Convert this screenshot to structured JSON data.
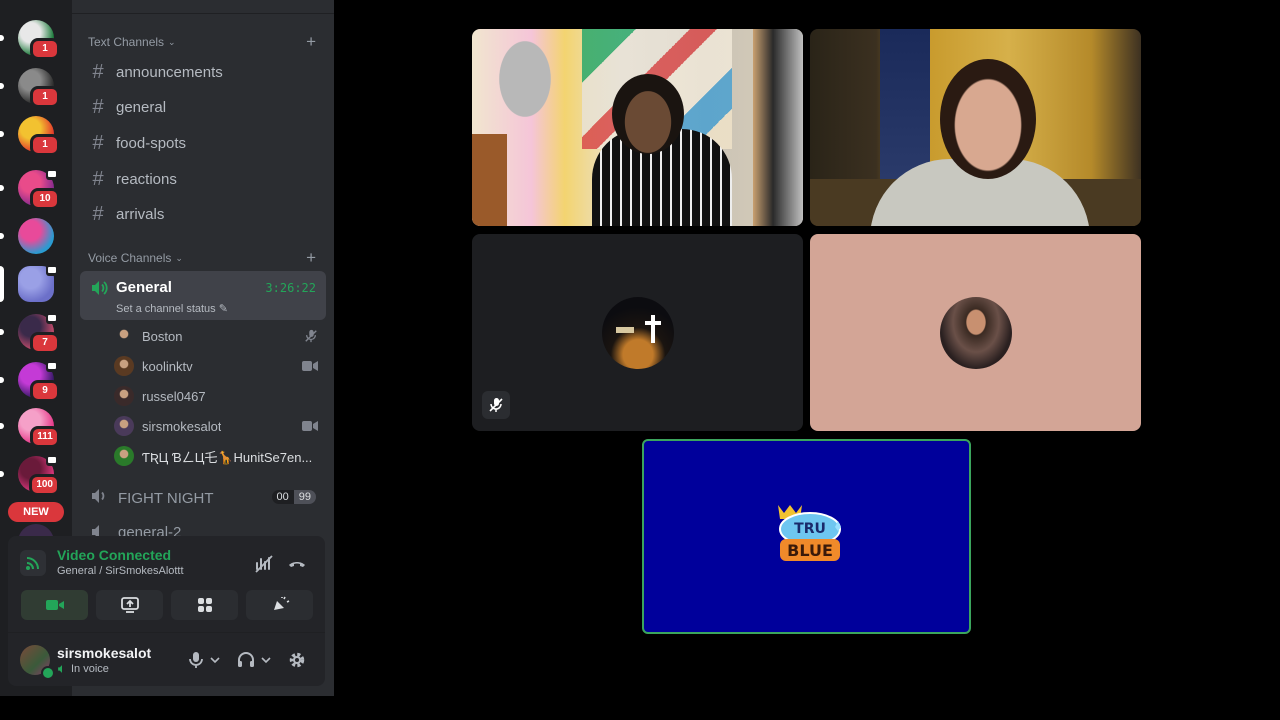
{
  "servers": [
    {
      "id": "s1",
      "badge": "1",
      "colors": [
        "#1b7a3a",
        "#e8e8e8"
      ],
      "active": false,
      "unread": true
    },
    {
      "id": "s2",
      "badge": "1",
      "colors": [
        "#2c2c2c",
        "#8a8a8a"
      ],
      "active": false,
      "unread": true
    },
    {
      "id": "s3",
      "badge": "1",
      "colors": [
        "#e33a2b",
        "#f2c230"
      ],
      "active": false,
      "unread": true
    },
    {
      "id": "s4",
      "badge": "10",
      "colors": [
        "#8a2b8f",
        "#e94b8a"
      ],
      "active": false,
      "unread": true,
      "video": true
    },
    {
      "id": "s5",
      "badge": "",
      "colors": [
        "#2a9bd1",
        "#e84a9a"
      ],
      "active": false,
      "unread": true
    },
    {
      "id": "s6",
      "badge": "",
      "colors": [
        "#6c70c9",
        "#9aa0e6"
      ],
      "active": true,
      "unread": false,
      "video": true
    },
    {
      "id": "s7",
      "badge": "7",
      "colors": [
        "#c04a6a",
        "#3a2a4a"
      ],
      "active": false,
      "unread": true,
      "video": true
    },
    {
      "id": "s8",
      "badge": "9",
      "colors": [
        "#3a1a6a",
        "#c43ad6"
      ],
      "active": false,
      "unread": true,
      "speaker": true
    },
    {
      "id": "s9",
      "badge": "111",
      "colors": [
        "#e63a8a",
        "#f5a0c8"
      ],
      "active": false,
      "unread": true
    },
    {
      "id": "s10",
      "badge": "100",
      "colors": [
        "#d6367a",
        "#6a1a3a"
      ],
      "active": false,
      "unread": true,
      "video": true
    }
  ],
  "new_tag": "NEW",
  "peek_badge": "10",
  "text_category": "Text Channels",
  "text_channels": [
    "announcements",
    "general",
    "food-spots",
    "reactions",
    "arrivals"
  ],
  "voice_category": "Voice Channels",
  "active_voice": {
    "name": "General",
    "timer": "3:26:22",
    "status": "Set a channel status"
  },
  "voice_users": [
    {
      "name": "Boston",
      "icon": "mic-muted-icon",
      "avatar": "#2b2d31"
    },
    {
      "name": "koolinktv",
      "icon": "video-icon",
      "avatar": "#5a3a22"
    },
    {
      "name": "russel0467",
      "icon": "",
      "avatar": "#3a2a2a"
    },
    {
      "name": "sirsmokesalot",
      "icon": "video-icon",
      "avatar": "#4a3a5a"
    },
    {
      "name": "ƬƦЦ ƁㄥЦ乇🦒HunitSe7en...",
      "icon": "",
      "avatar": "#2a7a2a",
      "bright": true
    }
  ],
  "fight_night": {
    "name": "FIGHT NIGHT",
    "count_a": "00",
    "count_b": "99"
  },
  "general2": "general-2",
  "rtc": {
    "title": "Video Connected",
    "subtitle": "General / SirSmokesAlottt"
  },
  "user": {
    "name": "sirsmokesalot",
    "status": "In voice"
  },
  "colors": {
    "accent_green": "#23a559",
    "danger": "#da373c",
    "blue_tile": "#00009b",
    "pink_tile": "#d3a596"
  }
}
